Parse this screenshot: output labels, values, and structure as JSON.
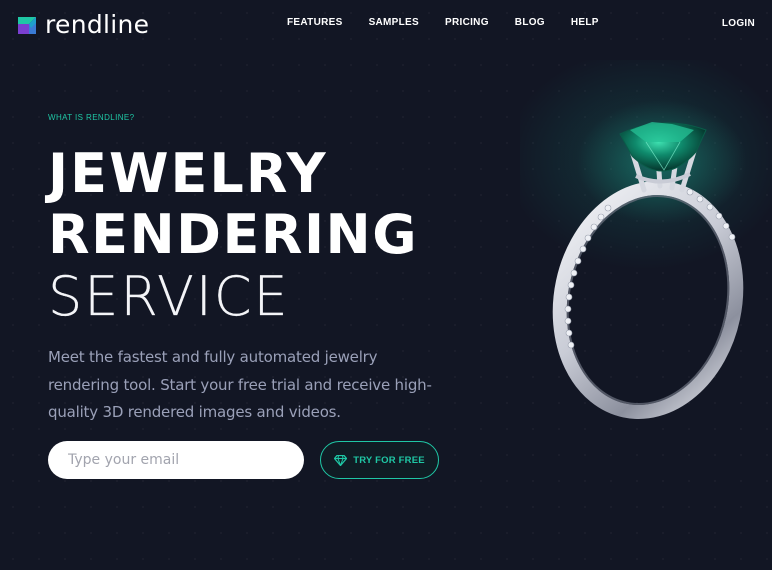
{
  "brand": {
    "name_part1": "rend",
    "name_part2": "line",
    "logo_icon": "rendline-logo-icon",
    "accent_color": "#1fc7a5"
  },
  "nav": {
    "items": [
      {
        "label": "FEATURES"
      },
      {
        "label": "SAMPLES"
      },
      {
        "label": "PRICING"
      },
      {
        "label": "BLOG"
      },
      {
        "label": "HELP"
      }
    ],
    "login_label": "LOGIN"
  },
  "hero": {
    "eyebrow": "WHAT IS RENDLINE?",
    "title_line1": "JEWELRY",
    "title_line2": "RENDERING",
    "title_line3": "SERVICE",
    "description": "Meet the fastest and fully automated jewelry rendering tool. Start your free trial and receive high-quality 3D rendered images and videos.",
    "email_placeholder": "Type your email",
    "email_value": "",
    "cta_label": "TRY FOR FREE",
    "cta_icon": "diamond-icon",
    "image": "emerald-ring-image"
  }
}
